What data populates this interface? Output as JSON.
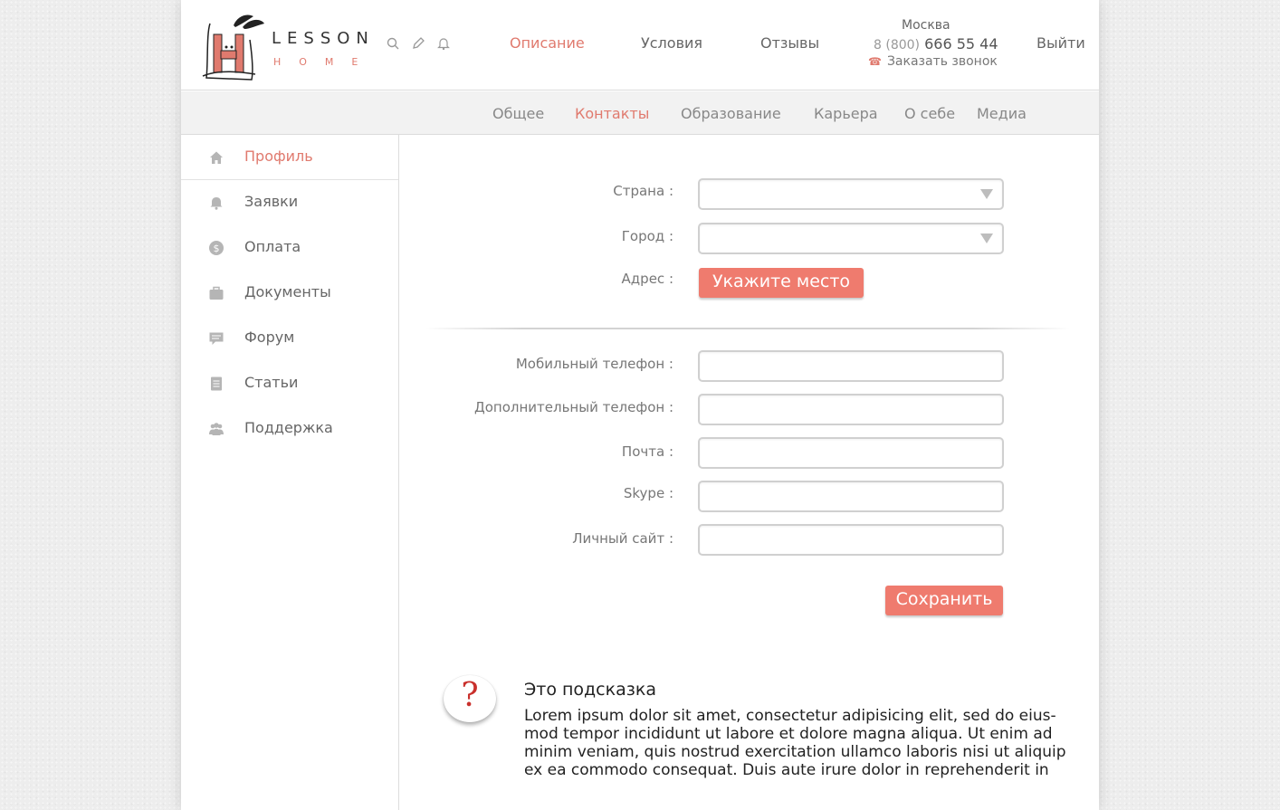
{
  "logo": {
    "word1": "LESSON",
    "word2": "HOME"
  },
  "header": {
    "icons": [
      "search-icon",
      "pencil-icon",
      "bell-icon"
    ],
    "nav": [
      {
        "label": "Описание",
        "active": true
      },
      {
        "label": "Условия",
        "active": false
      },
      {
        "label": "Отзывы",
        "active": false
      }
    ],
    "city": "Москва",
    "phone_code": "8 (800)",
    "phone_number": "666 55 44",
    "callback_label": "Заказать звонок",
    "logout_label": "Выйти"
  },
  "subnav": [
    {
      "label": "Общее",
      "active": false
    },
    {
      "label": "Контакты",
      "active": true
    },
    {
      "label": "Образование",
      "active": false
    },
    {
      "label": "Карьера",
      "active": false
    },
    {
      "label": "О себе",
      "active": false
    },
    {
      "label": "Медиа",
      "active": false
    }
  ],
  "sidebar": [
    {
      "label": "Профиль",
      "icon": "home-icon",
      "active": true
    },
    {
      "label": "Заявки",
      "icon": "bell-icon",
      "active": false
    },
    {
      "label": "Оплата",
      "icon": "dollar-icon",
      "active": false
    },
    {
      "label": "Документы",
      "icon": "briefcase-icon",
      "active": false
    },
    {
      "label": "Форум",
      "icon": "chat-icon",
      "active": false
    },
    {
      "label": "Статьи",
      "icon": "document-icon",
      "active": false
    },
    {
      "label": "Поддержка",
      "icon": "users-icon",
      "active": false
    }
  ],
  "form": {
    "country_label": "Страна :",
    "city_label": "Город :",
    "address_label": "Адрес :",
    "address_button": "Укажите место",
    "mobile_label": "Мобильный телефон :",
    "extra_phone_label": "Дополнительный телефон :",
    "email_label": "Почта :",
    "skype_label": "Skype :",
    "website_label": "Личный сайт :",
    "save_button": "Сохранить"
  },
  "hint": {
    "title": "Это подсказка",
    "text": "Lorem ipsum dolor sit amet, consectetur adipisicing elit, sed do eius-mod tempor incididunt ut labore et dolore magna aliqua. Ut enim ad minim veniam, quis nostrud exercitation ullamco laboris nisi ut aliquip ex ea commodo consequat. Duis aute irure dolor in reprehenderit in"
  },
  "colors": {
    "accent": "#ef7b6e",
    "text": "#666666",
    "hint_mark": "#c9302c"
  }
}
